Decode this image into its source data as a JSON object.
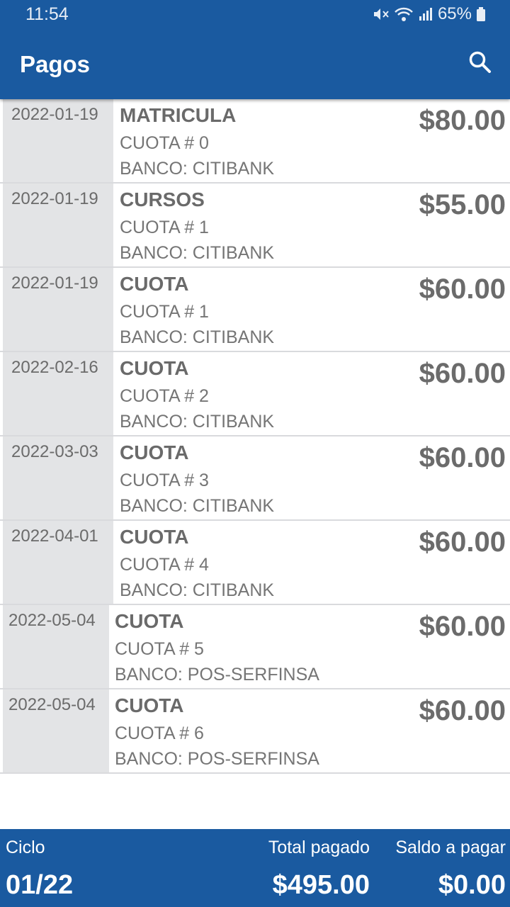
{
  "status_bar": {
    "time": "11:54",
    "battery": "65%",
    "icons": [
      "mute-icon",
      "wifi-icon",
      "signal-icon",
      "battery-icon"
    ]
  },
  "appbar": {
    "title": "Pagos",
    "search_icon": "search-icon"
  },
  "payments": [
    {
      "date": "2022-01-19",
      "concept": "MATRICULA",
      "cuota": "CUOTA # 0",
      "banco": "BANCO: CITIBANK",
      "amount": "$80.00"
    },
    {
      "date": "2022-01-19",
      "concept": "CURSOS",
      "cuota": "CUOTA # 1",
      "banco": "BANCO: CITIBANK",
      "amount": "$55.00"
    },
    {
      "date": "2022-01-19",
      "concept": "CUOTA",
      "cuota": "CUOTA # 1",
      "banco": "BANCO: CITIBANK",
      "amount": "$60.00"
    },
    {
      "date": "2022-02-16",
      "concept": "CUOTA",
      "cuota": "CUOTA # 2",
      "banco": "BANCO: CITIBANK",
      "amount": "$60.00"
    },
    {
      "date": "2022-03-03",
      "concept": "CUOTA",
      "cuota": "CUOTA # 3",
      "banco": "BANCO: CITIBANK",
      "amount": "$60.00"
    },
    {
      "date": "2022-04-01",
      "concept": "CUOTA",
      "cuota": "CUOTA # 4",
      "banco": "BANCO: CITIBANK",
      "amount": "$60.00"
    },
    {
      "date": "2022-05-04",
      "concept": "CUOTA",
      "cuota": "CUOTA # 5",
      "banco": "BANCO: POS-SERFINSA",
      "amount": "$60.00"
    },
    {
      "date": "2022-05-04",
      "concept": "CUOTA",
      "cuota": "CUOTA # 6",
      "banco": "BANCO: POS-SERFINSA",
      "amount": "$60.00"
    }
  ],
  "footer": {
    "ciclo_label": "Ciclo",
    "ciclo_value": "01/22",
    "total_label": "Total pagado",
    "total_value": "$495.00",
    "saldo_label": "Saldo a pagar",
    "saldo_value": "$0.00"
  },
  "colors": {
    "primary": "#1a5aa0",
    "date_bg": "#e3e4e6",
    "text": "#6b6b6b"
  }
}
